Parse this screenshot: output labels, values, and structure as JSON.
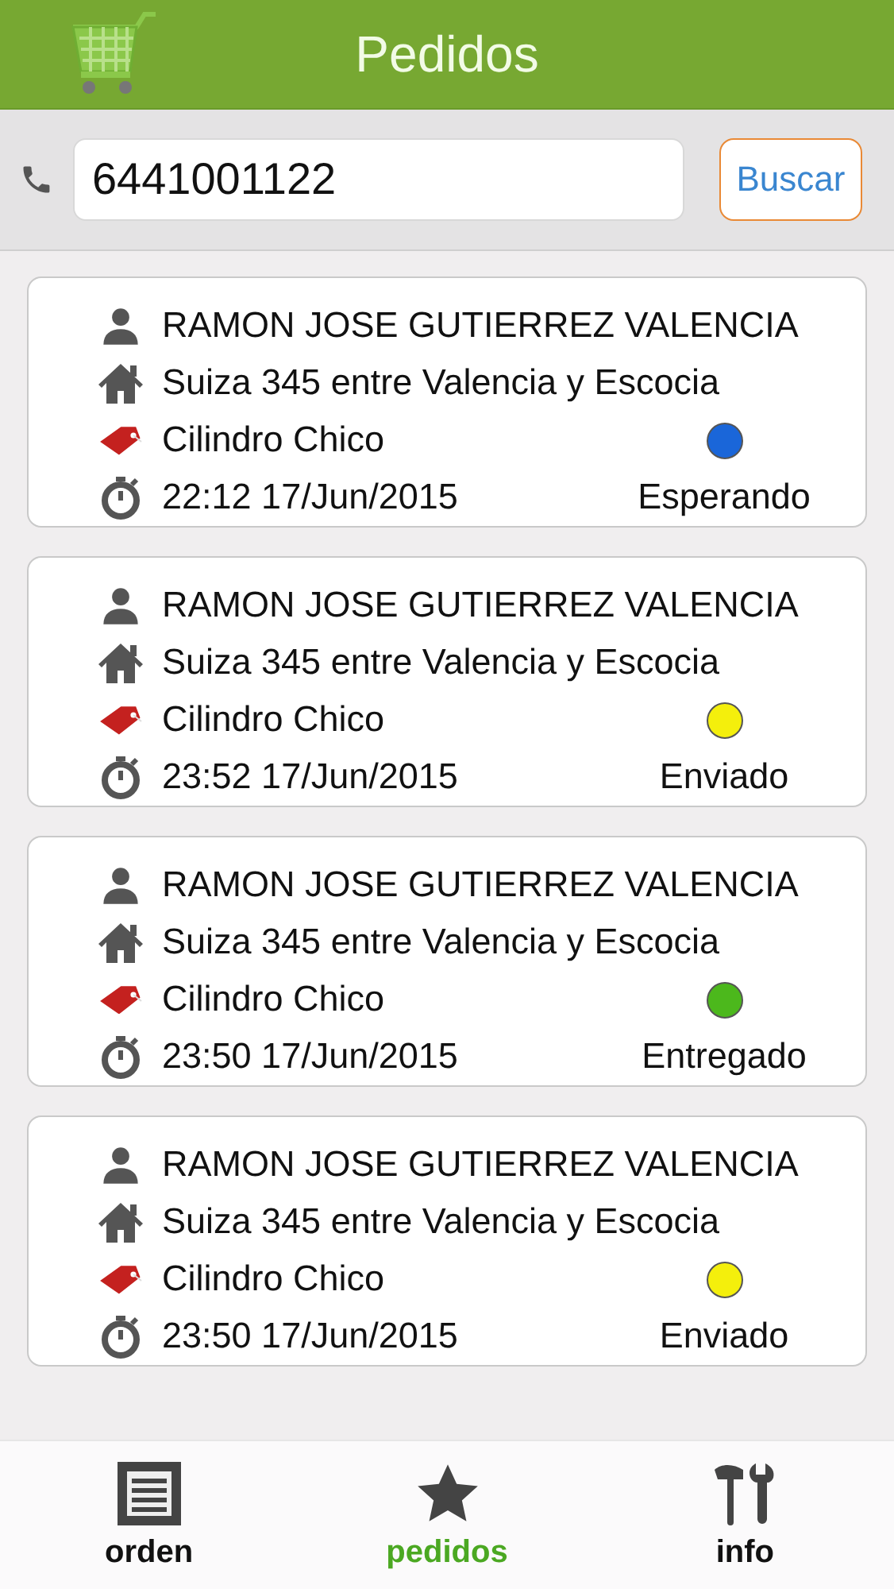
{
  "header": {
    "title": "Pedidos"
  },
  "search": {
    "value": "6441001122",
    "button": "Buscar"
  },
  "orders": [
    {
      "name": "RAMON JOSE GUTIERREZ VALENCIA",
      "address": "Suiza 345 entre Valencia y Escocia",
      "product": "Cilindro Chico",
      "time": "22:12 17/Jun/2015",
      "status": "Esperando",
      "color": "#1a66d9"
    },
    {
      "name": "RAMON JOSE GUTIERREZ VALENCIA",
      "address": "Suiza 345 entre Valencia y Escocia",
      "product": "Cilindro Chico",
      "time": "23:52 17/Jun/2015",
      "status": "Enviado",
      "color": "#f4ef0c"
    },
    {
      "name": "RAMON JOSE GUTIERREZ VALENCIA",
      "address": "Suiza 345 entre Valencia y Escocia",
      "product": "Cilindro Chico",
      "time": "23:50 17/Jun/2015",
      "status": "Entregado",
      "color": "#4cb81c"
    },
    {
      "name": "RAMON JOSE GUTIERREZ VALENCIA",
      "address": "Suiza 345 entre Valencia y Escocia",
      "product": "Cilindro Chico",
      "time": "23:50 17/Jun/2015",
      "status": "Enviado",
      "color": "#f4ef0c"
    }
  ],
  "tabs": [
    {
      "kind": "list",
      "label": "orden",
      "selected": false
    },
    {
      "kind": "star",
      "label": "pedidos",
      "selected": true
    },
    {
      "kind": "tools",
      "label": "info",
      "selected": false
    }
  ]
}
